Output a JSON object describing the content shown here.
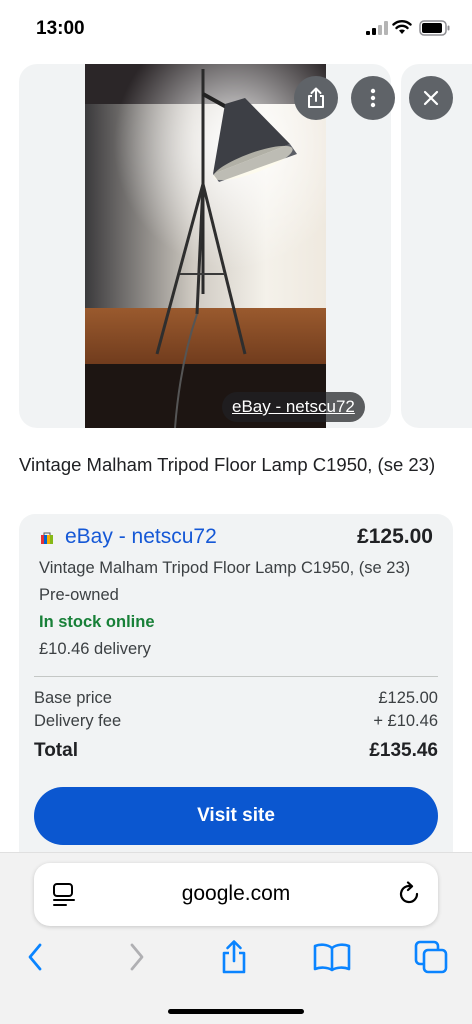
{
  "status_bar": {
    "time": "13:00"
  },
  "image_viewer": {
    "source_label": "eBay - netscu72",
    "buttons": {
      "share_icon": "share-icon",
      "more_icon": "more-vertical-icon",
      "close_icon": "close-icon"
    }
  },
  "product": {
    "title": "Vintage Malham Tripod Floor Lamp C1950, (se 23)"
  },
  "offer": {
    "merchant": "eBay - netscu72",
    "price": "£125.00",
    "description": "Vintage Malham Tripod Floor Lamp C1950, (se 23)",
    "condition": "Pre-owned",
    "stock": "In stock online",
    "delivery": "£10.46 delivery",
    "base_price_label": "Base price",
    "base_price_value": "£125.00",
    "delivery_fee_label": "Delivery fee",
    "delivery_fee_value": "+ £10.46",
    "total_label": "Total",
    "total_value": "£135.46",
    "visit_button": "Visit site"
  },
  "browser": {
    "address": "google.com",
    "toolbar_icons": [
      "back-icon",
      "forward-icon",
      "share-icon",
      "bookmarks-icon",
      "tabs-icon"
    ]
  },
  "colors": {
    "link_blue": "#1558d6",
    "button_blue": "#0b57d0",
    "stock_green": "#188038",
    "card_bg": "#f1f3f4",
    "ios_blue": "#0a84ff"
  }
}
